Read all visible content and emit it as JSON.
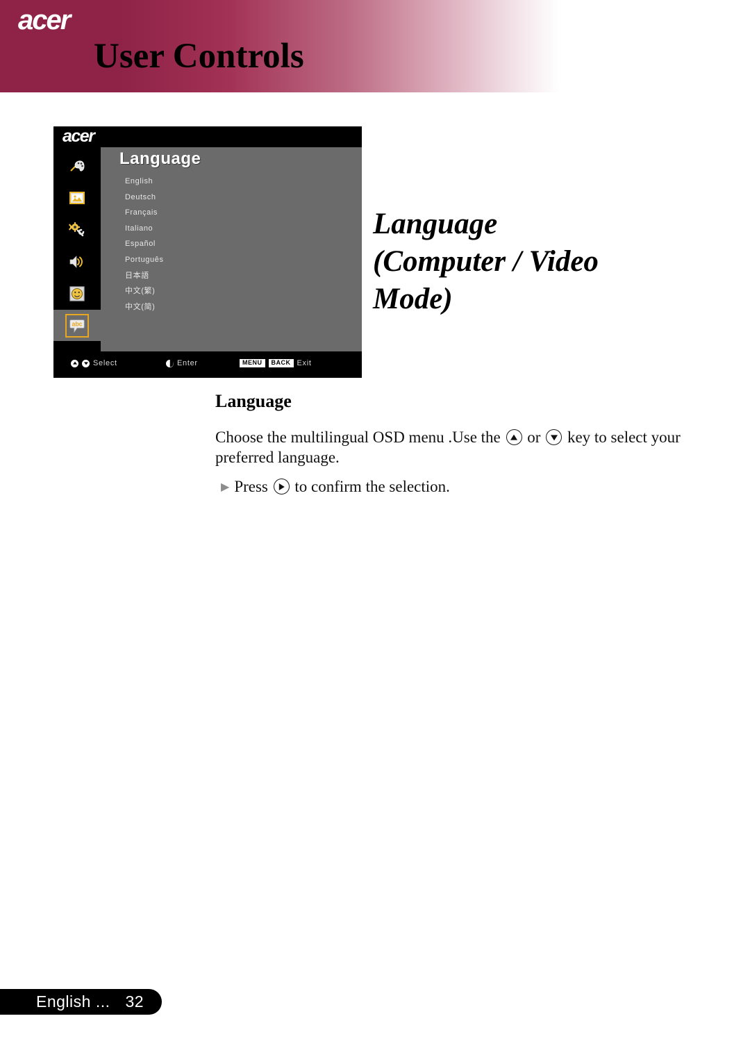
{
  "brand": "acer",
  "header": {
    "logo_text": "acer",
    "title": "User Controls"
  },
  "osd": {
    "logo_text": "acer",
    "title": "Language",
    "languages": [
      "English",
      "Deutsch",
      "Français",
      "Italiano",
      "Español",
      "Português",
      "日本語",
      "中文(繁)",
      "中文(简)"
    ],
    "sidebar_icons": [
      "color-palette-icon",
      "image-icon",
      "setting-gear-wrench-icon",
      "audio-speaker-icon",
      "timer-face-icon",
      "language-abc-bubble-icon"
    ],
    "selected_sidebar_icon": "language-abc-bubble-icon",
    "hints": {
      "select_label": "Select",
      "enter_label": "Enter",
      "exit_label": "Exit",
      "menu_key": "MENU",
      "back_key": "BACK"
    },
    "colors": {
      "panel_gray": "#6b6b6b",
      "background_black": "#000000",
      "selection_border": "#e8a722"
    }
  },
  "side_heading": {
    "line1": "Language",
    "line2": "(Computer / Video",
    "line3": "Mode)"
  },
  "content": {
    "section_title": "Language",
    "paragraph_part1": "Choose the multilingual OSD menu .Use the",
    "paragraph_or": "or",
    "paragraph_part2": "key to select your preferred language.",
    "bullet_press": "Press",
    "bullet_tail": "to confirm the selection."
  },
  "footer": {
    "language_label": "English ...",
    "page_number": "32"
  },
  "theme": {
    "header_maroon": "#8e2247",
    "accent_gold": "#e8a722"
  }
}
